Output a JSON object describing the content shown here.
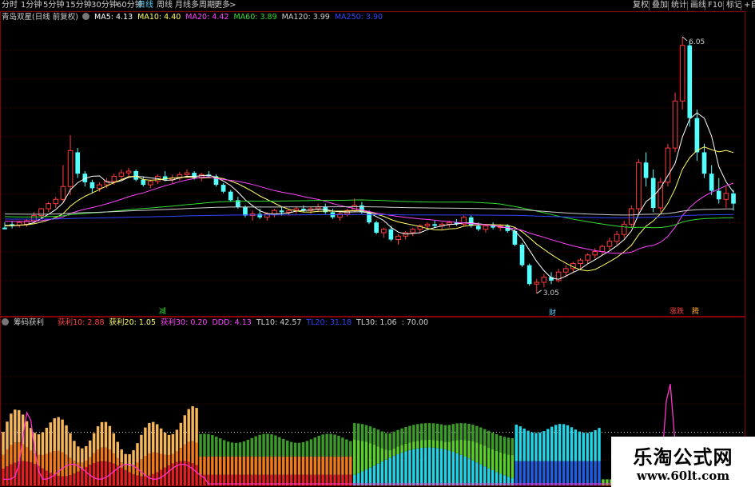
{
  "toolbar": {
    "periods": [
      "分时",
      "1分钟",
      "5分钟",
      "15分钟",
      "30分钟",
      "60分钟",
      "日线",
      "周线",
      "月线",
      "多周期",
      "更多"
    ],
    "active_period": "日线",
    "more_arrow": ">",
    "right_buttons": [
      "复权",
      "叠加",
      "统计",
      "画线",
      "F10",
      "标记",
      "+自"
    ]
  },
  "main_legend": {
    "stock_name": "青岛双星(日线 前复权)",
    "items": [
      {
        "label": "MA5: 4.13",
        "color": "#ffffff"
      },
      {
        "label": "MA10: 4.40",
        "color": "#ffff66"
      },
      {
        "label": "MA20: 4.42",
        "color": "#ff44ff"
      },
      {
        "label": "MA60: 3.89",
        "color": "#33dd33"
      },
      {
        "label": "MA120: 3.99",
        "color": "#cfcfcf"
      },
      {
        "label": "MA250: 3.90",
        "color": "#3344ff"
      }
    ]
  },
  "annotations": {
    "high": "6.05",
    "low": "3.05",
    "marker_jian": "减",
    "marker_cai": "财",
    "marker_zhangdie": "涨跌",
    "marker_fen": "腾"
  },
  "sub_legend": {
    "name": "筹码获利",
    "items": [
      {
        "label": "获利10: 2.88",
        "color": "#ff4444"
      },
      {
        "label": "获利20: 1.05",
        "color": "#ffff66"
      },
      {
        "label": "获利30: 0.20",
        "color": "#ff44ff"
      },
      {
        "label": "DDD: 4.13",
        "color": "#ff44ff"
      },
      {
        "label": "TL10: 42.57",
        "color": "#cfcfcf"
      },
      {
        "label": "TL20: 31.18",
        "color": "#3344ff"
      },
      {
        "label": "TL30: 1.06",
        "color": "#cfcfcf"
      },
      {
        "label": ": 70.00",
        "color": "#cfcfcf"
      }
    ]
  },
  "watermark": {
    "title": "乐淘公式网",
    "url": "www.60lt.com"
  },
  "chart_data": {
    "type": "candlestick",
    "title": "青岛双星(日线 前复权)",
    "ylim": [
      2.9,
      6.2
    ],
    "candles": [
      [
        3.82,
        3.88,
        3.8,
        3.8
      ],
      [
        3.86,
        3.89,
        3.81,
        3.85
      ],
      [
        3.85,
        3.9,
        3.82,
        3.88
      ],
      [
        3.86,
        3.92,
        3.83,
        3.9
      ],
      [
        3.9,
        4.0,
        3.88,
        3.96
      ],
      [
        3.96,
        4.05,
        3.92,
        4.04
      ],
      [
        4.04,
        4.12,
        4.0,
        4.1
      ],
      [
        4.1,
        4.18,
        4.05,
        4.15
      ],
      [
        4.15,
        4.55,
        4.12,
        4.3
      ],
      [
        4.3,
        4.9,
        4.2,
        4.72
      ],
      [
        4.7,
        4.75,
        4.4,
        4.45
      ],
      [
        4.45,
        4.48,
        4.3,
        4.35
      ],
      [
        4.35,
        4.38,
        4.22,
        4.28
      ],
      [
        4.28,
        4.35,
        4.24,
        4.32
      ],
      [
        4.32,
        4.4,
        4.28,
        4.36
      ],
      [
        4.36,
        4.45,
        4.32,
        4.42
      ],
      [
        4.42,
        4.5,
        4.38,
        4.46
      ],
      [
        4.46,
        4.52,
        4.4,
        4.48
      ],
      [
        4.48,
        4.5,
        4.36,
        4.38
      ],
      [
        4.38,
        4.42,
        4.3,
        4.32
      ],
      [
        4.32,
        4.38,
        4.28,
        4.36
      ],
      [
        4.36,
        4.44,
        4.33,
        4.42
      ],
      [
        4.42,
        4.48,
        4.36,
        4.38
      ],
      [
        4.38,
        4.44,
        4.34,
        4.4
      ],
      [
        4.4,
        4.47,
        4.37,
        4.44
      ],
      [
        4.44,
        4.5,
        4.4,
        4.46
      ],
      [
        4.46,
        4.48,
        4.38,
        4.4
      ],
      [
        4.4,
        4.46,
        4.36,
        4.44
      ],
      [
        4.44,
        4.48,
        4.4,
        4.42
      ],
      [
        4.42,
        4.44,
        4.3,
        4.32
      ],
      [
        4.32,
        4.34,
        4.22,
        4.24
      ],
      [
        4.24,
        4.26,
        4.12,
        4.14
      ],
      [
        4.14,
        4.18,
        4.04,
        4.06
      ],
      [
        4.06,
        4.08,
        3.94,
        3.96
      ],
      [
        3.96,
        4.02,
        3.9,
        3.98
      ],
      [
        3.98,
        4.04,
        3.92,
        3.94
      ],
      [
        3.94,
        4.0,
        3.9,
        3.98
      ],
      [
        3.98,
        4.04,
        3.94,
        4.02
      ],
      [
        4.02,
        4.06,
        3.96,
        4.0
      ],
      [
        4.0,
        4.04,
        3.96,
        4.02
      ],
      [
        4.02,
        4.06,
        3.98,
        4.04
      ],
      [
        4.04,
        4.08,
        4.0,
        4.02
      ],
      [
        4.02,
        4.06,
        3.98,
        4.04
      ],
      [
        4.04,
        4.1,
        4.0,
        4.06
      ],
      [
        4.06,
        4.1,
        3.98,
        4.0
      ],
      [
        4.0,
        4.04,
        3.92,
        3.94
      ],
      [
        3.94,
        4.0,
        3.9,
        3.98
      ],
      [
        3.98,
        4.04,
        3.95,
        4.02
      ],
      [
        4.02,
        4.16,
        4.0,
        4.08
      ],
      [
        4.08,
        4.12,
        3.98,
        4.0
      ],
      [
        4.0,
        4.02,
        3.86,
        3.88
      ],
      [
        3.88,
        3.9,
        3.74,
        3.76
      ],
      [
        3.76,
        3.82,
        3.7,
        3.8
      ],
      [
        3.8,
        3.84,
        3.66,
        3.68
      ],
      [
        3.68,
        3.74,
        3.62,
        3.72
      ],
      [
        3.72,
        3.78,
        3.68,
        3.76
      ],
      [
        3.76,
        3.82,
        3.72,
        3.8
      ],
      [
        3.8,
        3.86,
        3.76,
        3.84
      ],
      [
        3.84,
        3.88,
        3.8,
        3.86
      ],
      [
        3.86,
        3.9,
        3.82,
        3.84
      ],
      [
        3.84,
        3.88,
        3.8,
        3.86
      ],
      [
        3.86,
        3.9,
        3.82,
        3.88
      ],
      [
        3.88,
        3.92,
        3.84,
        3.86
      ],
      [
        3.86,
        3.96,
        3.84,
        3.94
      ],
      [
        3.94,
        3.96,
        3.82,
        3.84
      ],
      [
        3.84,
        3.88,
        3.78,
        3.8
      ],
      [
        3.8,
        3.86,
        3.76,
        3.84
      ],
      [
        3.84,
        3.88,
        3.8,
        3.82
      ],
      [
        3.82,
        3.86,
        3.78,
        3.84
      ],
      [
        3.84,
        3.86,
        3.76,
        3.78
      ],
      [
        3.78,
        3.8,
        3.6,
        3.62
      ],
      [
        3.62,
        3.64,
        3.36,
        3.38
      ],
      [
        3.38,
        3.4,
        3.14,
        3.16
      ],
      [
        3.16,
        3.22,
        3.05,
        3.18
      ],
      [
        3.18,
        3.28,
        3.12,
        3.24
      ],
      [
        3.24,
        3.3,
        3.16,
        3.2
      ],
      [
        3.2,
        3.34,
        3.18,
        3.3
      ],
      [
        3.3,
        3.38,
        3.24,
        3.34
      ],
      [
        3.34,
        3.42,
        3.3,
        3.4
      ],
      [
        3.4,
        3.46,
        3.34,
        3.44
      ],
      [
        3.44,
        3.52,
        3.4,
        3.5
      ],
      [
        3.5,
        3.58,
        3.46,
        3.54
      ],
      [
        3.54,
        3.62,
        3.5,
        3.6
      ],
      [
        3.6,
        3.7,
        3.56,
        3.66
      ],
      [
        3.66,
        3.78,
        3.62,
        3.74
      ],
      [
        3.74,
        3.9,
        3.7,
        3.86
      ],
      [
        3.86,
        4.08,
        3.82,
        4.04
      ],
      [
        4.04,
        4.62,
        3.98,
        4.58
      ],
      [
        4.58,
        4.7,
        4.3,
        4.4
      ],
      [
        4.4,
        4.5,
        4.0,
        4.05
      ],
      [
        4.05,
        4.4,
        4.0,
        4.35
      ],
      [
        4.35,
        4.8,
        4.3,
        4.75
      ],
      [
        4.75,
        5.4,
        4.7,
        5.3
      ],
      [
        5.3,
        6.05,
        5.2,
        5.95
      ],
      [
        5.95,
        6.0,
        5.0,
        5.1
      ],
      [
        5.1,
        5.2,
        4.6,
        4.7
      ],
      [
        4.7,
        4.8,
        4.4,
        4.45
      ],
      [
        4.45,
        4.55,
        4.2,
        4.25
      ],
      [
        4.25,
        4.4,
        4.1,
        4.15
      ],
      [
        4.15,
        4.3,
        4.05,
        4.22
      ],
      [
        4.22,
        4.26,
        4.02,
        4.1
      ]
    ],
    "sub_chart": {
      "type": "bar",
      "ylim": [
        0,
        100
      ],
      "ref_line": 70
    }
  }
}
